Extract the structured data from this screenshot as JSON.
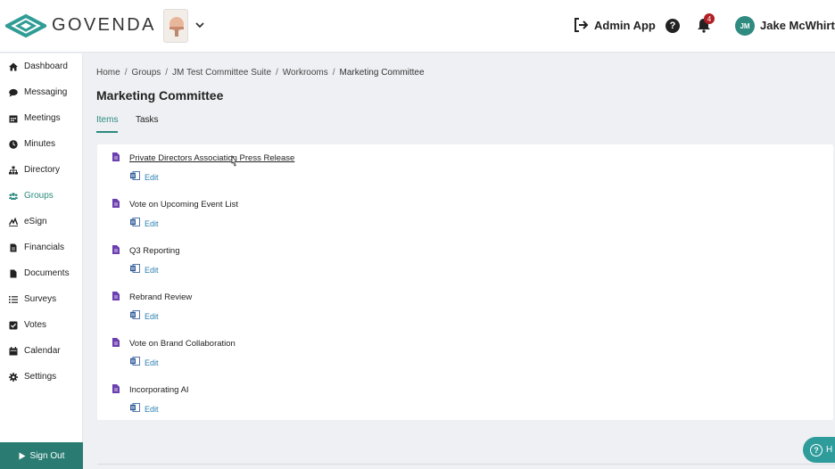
{
  "header": {
    "brand": "GOVENDA",
    "admin_app_label": "Admin App",
    "help_label": "?",
    "notification_count": "4",
    "user_initials": "JM",
    "user_name": "Jake McWhirter",
    "accent_color": "#2b8a7e"
  },
  "sidebar": {
    "items": [
      {
        "label": "Dashboard",
        "icon": "home-icon"
      },
      {
        "label": "Messaging",
        "icon": "chat-bubble-icon"
      },
      {
        "label": "Meetings",
        "icon": "calendar-grid-icon"
      },
      {
        "label": "Minutes",
        "icon": "clock-icon"
      },
      {
        "label": "Directory",
        "icon": "sitemap-icon"
      },
      {
        "label": "Groups",
        "icon": "users-icon",
        "active": true
      },
      {
        "label": "eSign",
        "icon": "signature-icon"
      },
      {
        "label": "Financials",
        "icon": "invoice-icon"
      },
      {
        "label": "Documents",
        "icon": "file-icon"
      },
      {
        "label": "Surveys",
        "icon": "list-icon"
      },
      {
        "label": "Votes",
        "icon": "checkbox-icon"
      },
      {
        "label": "Calendar",
        "icon": "calendar-icon"
      },
      {
        "label": "Settings",
        "icon": "gear-icon"
      }
    ],
    "signout_label": "Sign Out"
  },
  "breadcrumb": [
    "Home",
    "Groups",
    "JM Test Committee Suite",
    "Workrooms",
    "Marketing Committee"
  ],
  "page_title": "Marketing Committee",
  "tabs": [
    {
      "label": "Items",
      "active": true
    },
    {
      "label": "Tasks",
      "active": false
    }
  ],
  "items": [
    {
      "title": "Private Directors Association Press Release",
      "edit_label": "Edit"
    },
    {
      "title": "Vote on Upcoming Event List",
      "edit_label": "Edit"
    },
    {
      "title": "Q3 Reporting",
      "edit_label": "Edit"
    },
    {
      "title": "Rebrand Review",
      "edit_label": "Edit"
    },
    {
      "title": "Vote on Brand Collaboration",
      "edit_label": "Edit"
    },
    {
      "title": "Incorporating AI",
      "edit_label": "Edit"
    }
  ],
  "help_button_label": "H"
}
